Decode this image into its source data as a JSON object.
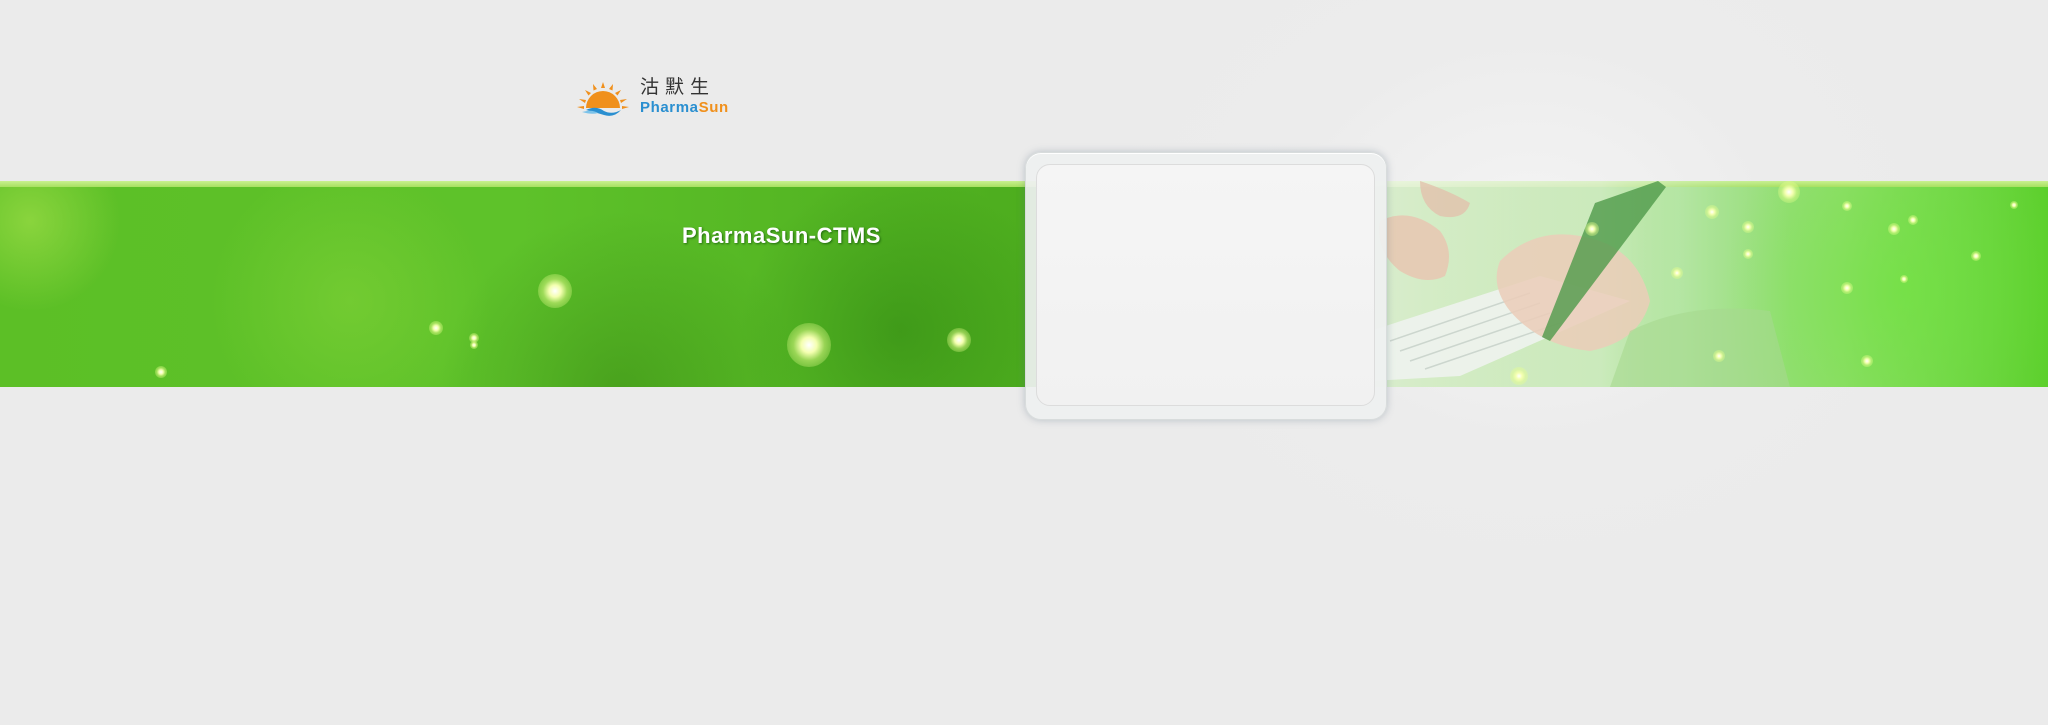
{
  "logo": {
    "name_cn": "沽默生",
    "name_en_part1": "Pharma",
    "name_en_part2": "Sun",
    "icon": "sun-wave-logo-icon"
  },
  "banner": {
    "title": "PharmaSun-CTMS"
  },
  "login_panel": {
    "state": "empty"
  },
  "colors": {
    "brand_blue": "#2a8fd0",
    "brand_orange": "#f0901c",
    "banner_green": "#5cbf26",
    "page_background": "#ebebeb"
  }
}
